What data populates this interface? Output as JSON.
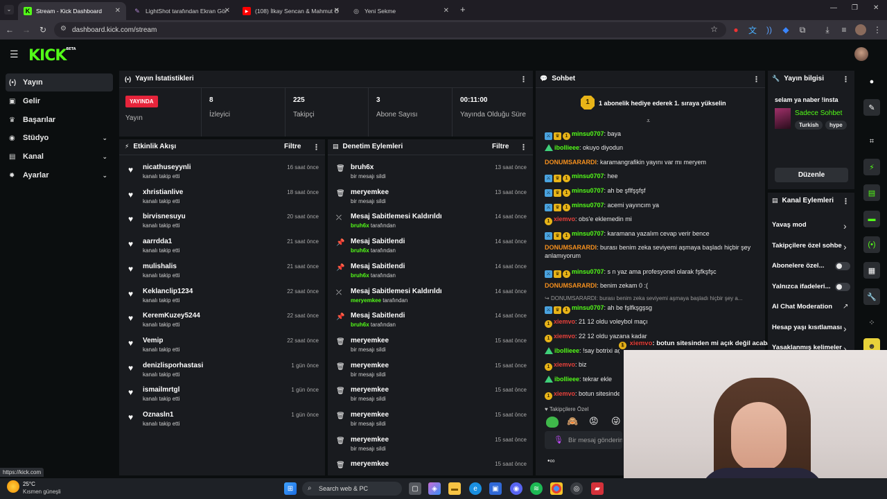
{
  "browser": {
    "tabs": [
      {
        "title": "Stream - Kick Dashboard",
        "active": true,
        "icon": "kick-icon"
      },
      {
        "title": "LightShot tarafından Ekran Gör",
        "active": false,
        "icon": "feather-icon"
      },
      {
        "title": "(108) İlkay Sencan & Mahmut Ö",
        "active": false,
        "icon": "youtube-icon"
      },
      {
        "title": "Yeni Sekme",
        "active": false,
        "icon": "globe-icon"
      }
    ],
    "url": "dashboard.kick.com/stream",
    "status_url": "https://kick.com"
  },
  "header": {
    "logo": "KICK",
    "logo_tag": "BETA"
  },
  "sidebar": {
    "items": [
      {
        "label": "Yayın",
        "icon": "broadcast-icon",
        "selected": true
      },
      {
        "label": "Gelir",
        "icon": "money-icon"
      },
      {
        "label": "Başarılar",
        "icon": "trophy-icon"
      },
      {
        "label": "Stüdyo",
        "icon": "studio-icon",
        "chevron": true
      },
      {
        "label": "Kanal",
        "icon": "channel-icon",
        "chevron": true
      },
      {
        "label": "Ayarlar",
        "icon": "gear-icon",
        "chevron": true
      }
    ]
  },
  "stats": {
    "title": "Yayın İstatistikleri",
    "live_badge": "YAYINDA",
    "live_label": "Yayın",
    "items": [
      {
        "value": "8",
        "label": "İzleyici"
      },
      {
        "value": "225",
        "label": "Takipçi"
      },
      {
        "value": "3",
        "label": "Abone Sayısı"
      },
      {
        "value": "00:11:00",
        "label": "Yayında Olduğu Süre"
      }
    ]
  },
  "activity": {
    "title": "Etkinlik Akışı",
    "filter": "Filtre",
    "rows": [
      {
        "name": "nicathuseyynli",
        "sub": "kanalı takip etti",
        "time": "16 saat önce"
      },
      {
        "name": "xhristianlive",
        "sub": "kanalı takip etti",
        "time": "18 saat önce"
      },
      {
        "name": "birvisnesuyu",
        "sub": "kanalı takip etti",
        "time": "20 saat önce"
      },
      {
        "name": "aarrdda1",
        "sub": "kanalı takip etti",
        "time": "21 saat önce"
      },
      {
        "name": "mulishalis",
        "sub": "kanalı takip etti",
        "time": "21 saat önce"
      },
      {
        "name": "Keklanclip1234",
        "sub": "kanalı takip etti",
        "time": "22 saat önce"
      },
      {
        "name": "KeremKuzey5244",
        "sub": "kanalı takip etti",
        "time": "22 saat önce"
      },
      {
        "name": "Vemip",
        "sub": "kanalı takip etti",
        "time": "22 saat önce"
      },
      {
        "name": "denizlisporhastasi",
        "sub": "kanalı takip etti",
        "time": "1 gün önce"
      },
      {
        "name": "ismailmrtgl",
        "sub": "kanalı takip etti",
        "time": "1 gün önce"
      },
      {
        "name": "Oznasln1",
        "sub": "kanalı takip etti",
        "time": "1 gün önce"
      }
    ]
  },
  "moderation": {
    "title": "Denetim Eylemleri",
    "filter": "Filtre",
    "rows": [
      {
        "name": "bruh6x",
        "sub": "bir mesajı sildi",
        "by": "",
        "time": "13 saat önce",
        "icon": "trash-icon"
      },
      {
        "name": "meryemkee",
        "sub": "bir mesajı sildi",
        "by": "",
        "time": "13 saat önce",
        "icon": "trash-icon"
      },
      {
        "name": "Mesaj Sabitlemesi Kaldırıldı",
        "sub": "tarafından",
        "by": "bruh6x",
        "time": "14 saat önce",
        "icon": "unpin-icon"
      },
      {
        "name": "Mesaj Sabitlendi",
        "sub": "tarafından",
        "by": "bruh6x",
        "time": "14 saat önce",
        "icon": "pin-icon"
      },
      {
        "name": "Mesaj Sabitlendi",
        "sub": "tarafından",
        "by": "bruh6x",
        "time": "14 saat önce",
        "icon": "pin-icon"
      },
      {
        "name": "Mesaj Sabitlemesi Kaldırıldı",
        "sub": "tarafından",
        "by": "meryemkee",
        "time": "14 saat önce",
        "icon": "unpin-icon"
      },
      {
        "name": "Mesaj Sabitlendi",
        "sub": "tarafından",
        "by": "bruh6x",
        "time": "14 saat önce",
        "icon": "pin-icon"
      },
      {
        "name": "meryemkee",
        "sub": "bir mesajı sildi",
        "by": "",
        "time": "15 saat önce",
        "icon": "trash-icon"
      },
      {
        "name": "meryemkee",
        "sub": "bir mesajı sildi",
        "by": "",
        "time": "15 saat önce",
        "icon": "trash-icon"
      },
      {
        "name": "meryemkee",
        "sub": "bir mesajı sildi",
        "by": "",
        "time": "15 saat önce",
        "icon": "trash-icon"
      },
      {
        "name": "meryemkee",
        "sub": "bir mesajı sildi",
        "by": "",
        "time": "15 saat önce",
        "icon": "trash-icon"
      },
      {
        "name": "meryemkee",
        "sub": "bir mesajı sildi",
        "by": "",
        "time": "15 saat önce",
        "icon": "trash-icon"
      },
      {
        "name": "meryemkee",
        "sub": "",
        "by": "",
        "time": "15 saat önce",
        "icon": "trash-icon"
      }
    ]
  },
  "chat": {
    "title": "Sohbet",
    "gift_banner": "1 abonelik hediye ederek 1. sıraya yükselin",
    "gift_rank": "1",
    "messages": [
      {
        "user": "minsu0707",
        "text": ": baya",
        "color": "green",
        "badges": [
          "blue",
          "gold",
          "sub"
        ]
      },
      {
        "user": "ibollieee",
        "text": ": okuyo diyodun",
        "color": "green",
        "badges": [
          "green"
        ]
      },
      {
        "user": "DONUMSARARDI",
        "text": ": karamangrafikin yayını var mı meryem",
        "color": "orange",
        "badges": []
      },
      {
        "user": "minsu0707",
        "text": ": hee",
        "color": "green",
        "badges": [
          "blue",
          "gold",
          "sub"
        ]
      },
      {
        "user": "minsu0707",
        "text": ": ah be şflfşşfşf",
        "color": "green",
        "badges": [
          "blue",
          "gold",
          "sub"
        ]
      },
      {
        "user": "minsu0707",
        "text": ": acemi yayıncım ya",
        "color": "green",
        "badges": [
          "blue",
          "gold",
          "sub"
        ]
      },
      {
        "user": "xiemvo",
        "text": ": obs'e eklemedin mi",
        "color": "red",
        "badges": [
          "sub"
        ]
      },
      {
        "user": "minsu0707",
        "text": ": karamana yazalım cevap verir bence",
        "color": "green",
        "badges": [
          "blue",
          "gold",
          "sub"
        ]
      },
      {
        "user": "DONUMSARARDI",
        "text": ": burası benim zeka seviyemi aşmaya başladı hiçbir şey anlamıyorum",
        "color": "orange",
        "badges": []
      },
      {
        "user": "minsu0707",
        "text": ": s n yaz ama profesyonel olarak fşfkşfşc",
        "color": "green",
        "badges": [
          "blue",
          "gold",
          "sub"
        ]
      },
      {
        "user": "DONUMSARARDI",
        "text": ": benim zekam 0 :(",
        "color": "orange",
        "badges": []
      },
      {
        "user": "minsu0707",
        "text": ": ah be fşlfkşgşsg",
        "color": "green",
        "badges": [
          "blue",
          "gold",
          "sub"
        ]
      },
      {
        "user": "xiemvo",
        "text": ": 21 12 oldu voleybol maçı",
        "color": "red",
        "badges": [
          "sub"
        ]
      },
      {
        "user": "xiemvo",
        "text": ": 22 12 oldu yazana kadar",
        "color": "red",
        "badges": [
          "sub"
        ]
      },
      {
        "user": "ibollieee",
        "text": ": !say botrixi aç",
        "color": "green",
        "badges": [
          "green"
        ]
      },
      {
        "user": "xiemvo",
        "text": ": biz",
        "color": "red",
        "badges": [
          "sub"
        ]
      },
      {
        "user": "ibollieee",
        "text": ": tekrar ekle",
        "color": "green",
        "badges": [
          "green"
        ]
      },
      {
        "user": "xiemvo",
        "text": ": botun sitesinde",
        "color": "red",
        "badges": [
          "sub"
        ]
      }
    ],
    "reply_preview": "DONUMSARARDI: burası benim zeka seviyemi aşmaya başladı hiçbir şey a...",
    "pinned_overlay_user": "xiemvo",
    "pinned_overlay_text": ": botun sitesinden mi açık değil acaba",
    "followers_only": "Takipçilere Özel",
    "input_placeholder": "Bir mesaj gönderin"
  },
  "stream_info": {
    "title": "Yayın bilgisi",
    "stream_title": "selam ya naber !insta",
    "category": "Sadece Sohbet",
    "tags": [
      "Turkish",
      "hype"
    ],
    "edit": "Düzenle"
  },
  "channel_actions": {
    "title": "Kanal Eylemleri",
    "items": [
      {
        "label": "Yavaş mod",
        "kind": "chevron"
      },
      {
        "label": "Takipçilere özel sohbe",
        "kind": "chevron"
      },
      {
        "label": "Abonelere özel...",
        "kind": "toggle"
      },
      {
        "label": "Yalnızca ifadeleri...",
        "kind": "toggle"
      },
      {
        "label": "AI Chat Moderation",
        "kind": "external"
      },
      {
        "label": "Hesap yaşı kısıtlaması",
        "kind": "chevron"
      },
      {
        "label": "Yasaklanmış kelimeler",
        "kind": "chevron"
      }
    ]
  },
  "taskbar": {
    "temp": "25°C",
    "weather": "Kısmen güneşli",
    "search": "Search web & PC"
  },
  "colors": {
    "accent": "#53fc18",
    "live": "#e6243b",
    "bg": "#0b0e0f",
    "panel": "#191b1f"
  }
}
